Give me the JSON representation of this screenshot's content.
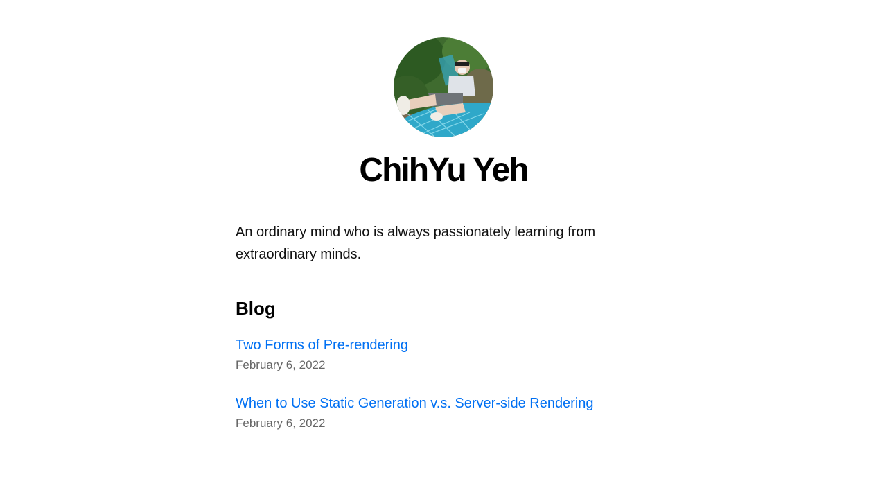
{
  "profile": {
    "name": "ChihYu Yeh",
    "avatar_icon": "profile-photo",
    "bio": "An ordinary mind who is always passionately learning from extraordinary minds."
  },
  "blog": {
    "title": "Blog",
    "posts": [
      {
        "title": "Two Forms of Pre-rendering",
        "date": "February 6, 2022"
      },
      {
        "title": "When to Use Static Generation v.s. Server-side Rendering",
        "date": "February 6, 2022"
      }
    ]
  },
  "colors": {
    "link": "#0070f3",
    "date": "#666666",
    "text": "#000000",
    "background": "#ffffff"
  }
}
